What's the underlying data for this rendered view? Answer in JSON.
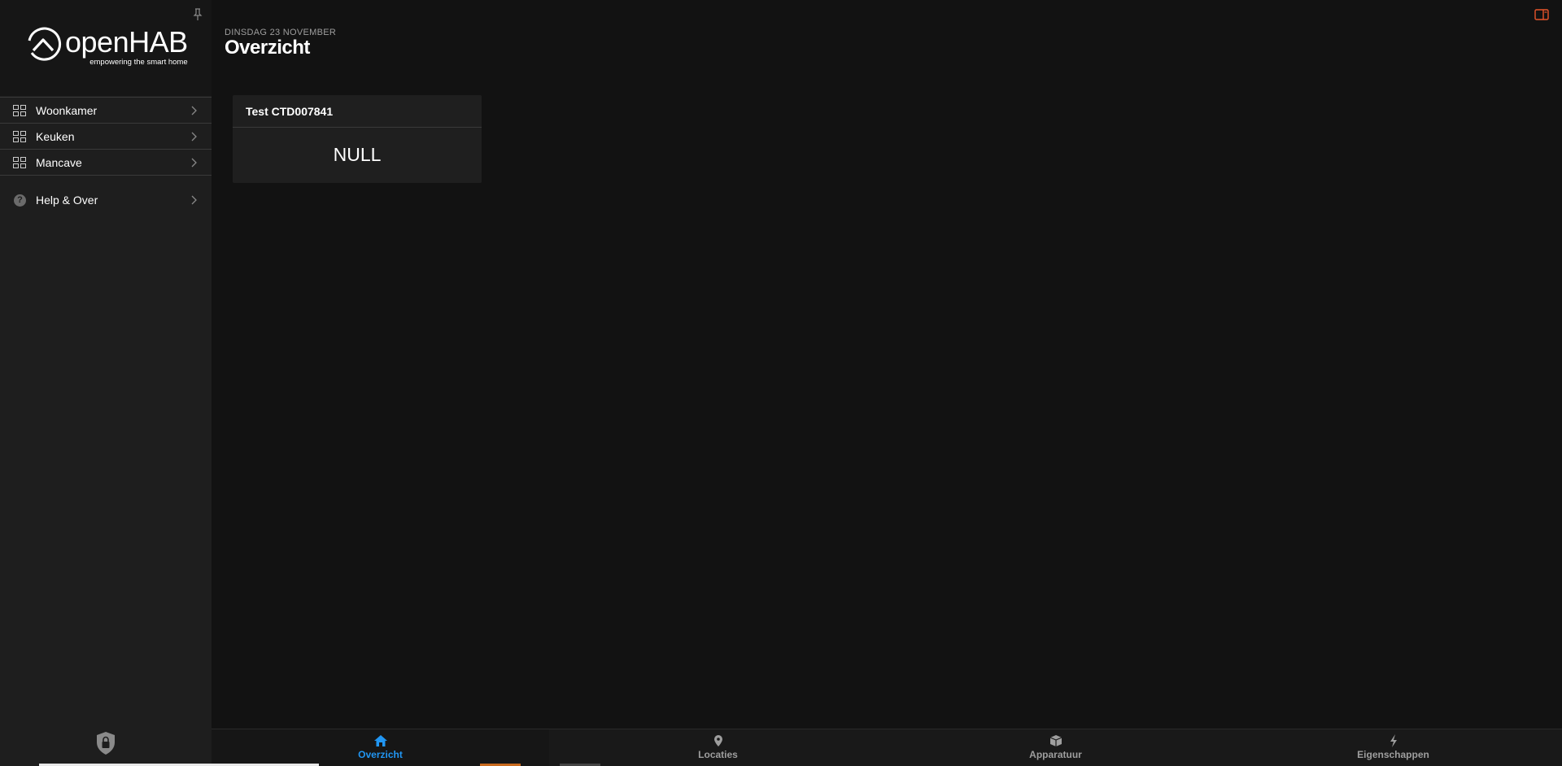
{
  "brand": {
    "name": "openHAB",
    "tagline": "empowering the smart home"
  },
  "sidebar": {
    "items": [
      {
        "label": "Woonkamer"
      },
      {
        "label": "Keuken"
      },
      {
        "label": "Mancave"
      }
    ],
    "help": {
      "label": "Help & Over"
    }
  },
  "header": {
    "date": "DINSDAG 23 NOVEMBER",
    "title": "Overzicht"
  },
  "card": {
    "title": "Test CTD007841",
    "value": "NULL"
  },
  "tabs": [
    {
      "label": "Overzicht",
      "icon": "home-icon",
      "active": true
    },
    {
      "label": "Locaties",
      "icon": "location-pin-icon",
      "active": false
    },
    {
      "label": "Apparatuur",
      "icon": "box-icon",
      "active": false
    },
    {
      "label": "Eigenschappen",
      "icon": "bolt-icon",
      "active": false
    }
  ],
  "colors": {
    "active_tab": "#2196f3",
    "accent": "#e8552b",
    "background": "#121212",
    "sidebar": "#1e1e1e"
  }
}
